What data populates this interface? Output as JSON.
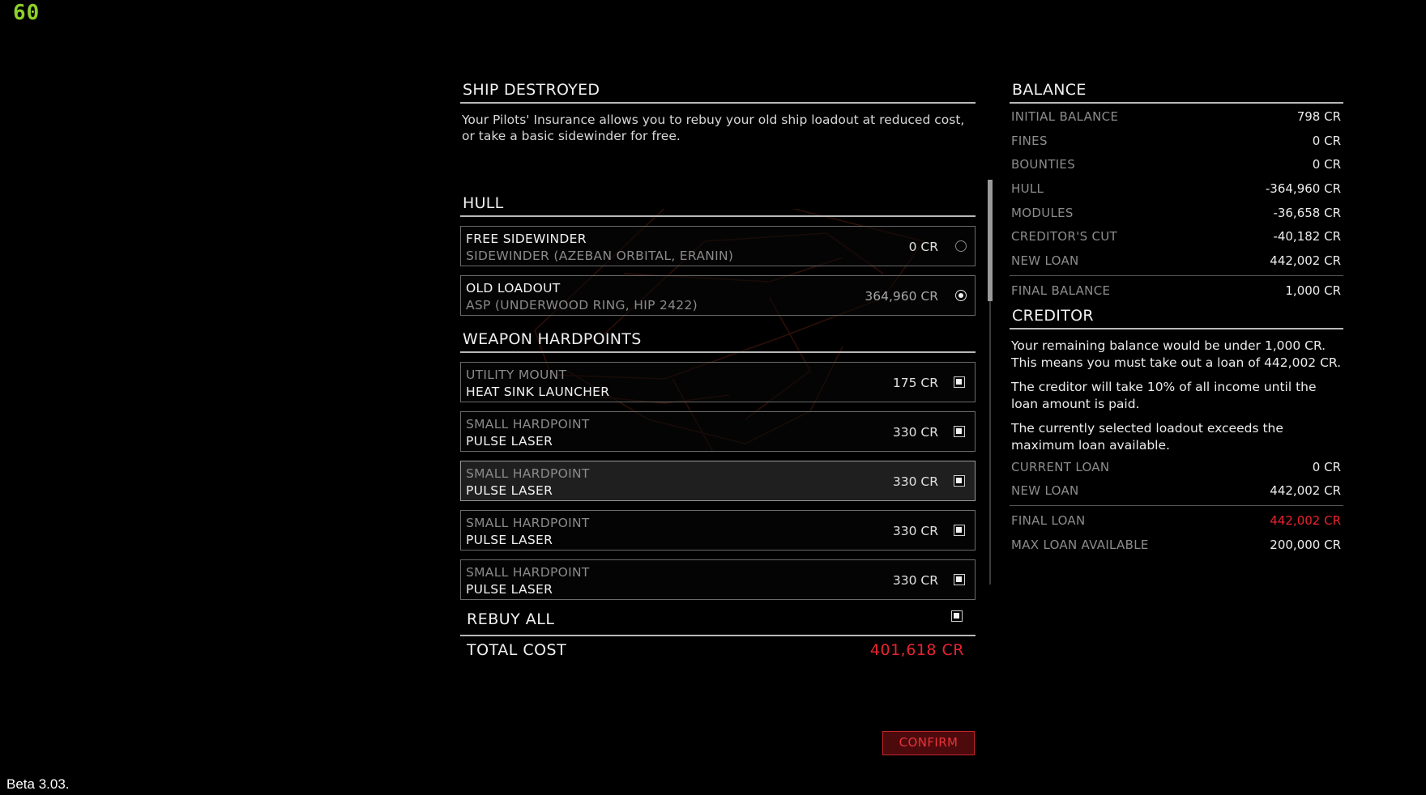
{
  "overlay": {
    "fps": "60",
    "build": "Beta 3.03."
  },
  "ship_destroyed": {
    "title": "SHIP DESTROYED",
    "intro_line1": "Your Pilots' Insurance allows you to rebuy your old ship loadout at reduced cost,",
    "intro_line2": "or take a basic sidewinder for free."
  },
  "hull": {
    "title": "HULL",
    "options": [
      {
        "name": "FREE SIDEWINDER",
        "detail": "SIDEWINDER (AZEBAN ORBITAL, ERANIN)",
        "price": "0 CR",
        "selected": false
      },
      {
        "name": "OLD LOADOUT",
        "detail": "ASP (UNDERWOOD RING, HIP 2422)",
        "price": "364,960 CR",
        "selected": true
      }
    ]
  },
  "weapons": {
    "title": "WEAPON HARDPOINTS",
    "items": [
      {
        "slot": "UTILITY MOUNT",
        "module": "HEAT SINK LAUNCHER",
        "price": "175 CR",
        "checked": true
      },
      {
        "slot": "SMALL HARDPOINT",
        "module": "PULSE LASER",
        "price": "330 CR",
        "checked": true
      },
      {
        "slot": "SMALL HARDPOINT",
        "module": "PULSE LASER",
        "price": "330 CR",
        "checked": true
      },
      {
        "slot": "SMALL HARDPOINT",
        "module": "PULSE LASER",
        "price": "330 CR",
        "checked": true
      },
      {
        "slot": "SMALL HARDPOINT",
        "module": "PULSE LASER",
        "price": "330 CR",
        "checked": true
      }
    ]
  },
  "rebuy_all": {
    "label": "REBUY ALL",
    "checked": true
  },
  "total": {
    "label": "TOTAL COST",
    "value": "401,618 CR"
  },
  "confirm": {
    "label": "CONFIRM"
  },
  "balance": {
    "title": "BALANCE",
    "rows": [
      {
        "label": "INITIAL BALANCE",
        "value": "798 CR"
      },
      {
        "label": "FINES",
        "value": "0 CR"
      },
      {
        "label": "BOUNTIES",
        "value": "0 CR"
      },
      {
        "label": "HULL",
        "value": "-364,960 CR"
      },
      {
        "label": "MODULES",
        "value": "-36,658 CR"
      },
      {
        "label": "CREDITOR'S CUT",
        "value": "-40,182 CR"
      },
      {
        "label": "NEW LOAN",
        "value": "442,002 CR"
      }
    ],
    "final": {
      "label": "FINAL BALANCE",
      "value": "1,000 CR"
    }
  },
  "creditor": {
    "title": "CREDITOR",
    "para1_line1": "Your remaining balance would be under 1,000 CR.",
    "para1_line2": "This means you must take out a loan of 442,002 CR.",
    "para2_line1": "The creditor will take 10% of all income until the",
    "para2_line2": "loan amount is paid.",
    "para3_line1": "The currently selected loadout exceeds the",
    "para3_line2": "maximum loan available.",
    "rows": [
      {
        "label": "CURRENT LOAN",
        "value": "0 CR"
      },
      {
        "label": "NEW LOAN",
        "value": "442,002 CR"
      }
    ],
    "final_loan": {
      "label": "FINAL LOAN",
      "value": "442,002 CR"
    },
    "max_loan": {
      "label": "MAX LOAN AVAILABLE",
      "value": "200,000 CR"
    }
  },
  "colors": {
    "accent_red": "#e8232f",
    "fps_green": "#8ed02b",
    "confirm_bg": "#4d0a0c"
  }
}
